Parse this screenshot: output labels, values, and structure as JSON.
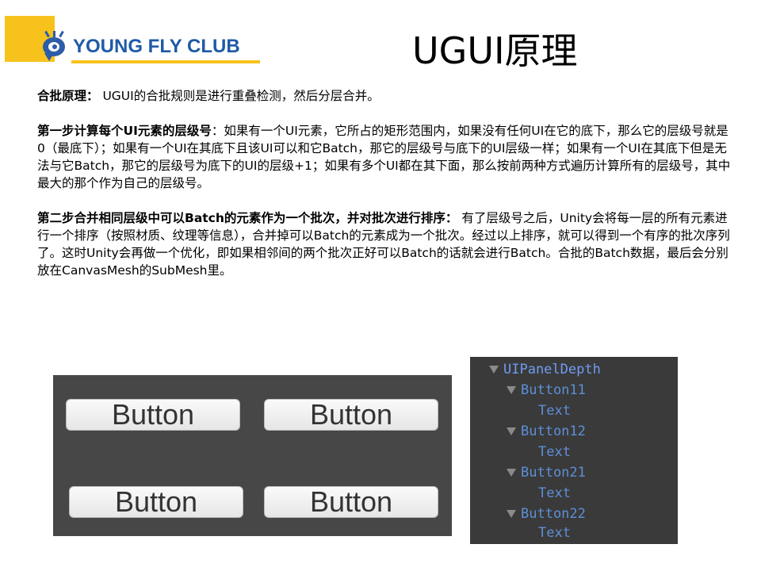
{
  "logo": {
    "text": "YOUNG FLY CLUB",
    "accent_color": "#f7c21c",
    "text_color": "#1f5aa8"
  },
  "title": "UGUI原理",
  "paragraphs": [
    {
      "heading": "合批原理：",
      "body": " UGUI的合批规则是进行重叠检测，然后分层合并。"
    },
    {
      "heading": "第一步计算每个UI元素的层级号",
      "body": "：如果有一个UI元素，它所占的矩形范围内，如果没有任何UI在它的底下，那么它的层级号就是0（最底下）；如果有一个UI在其底下且该UI可以和它Batch，那它的层级号与底下的UI层级一样；如果有一个UI在其底下但是无法与它Batch，那它的层级号为底下的UI的层级+1；如果有多个UI都在其下面，那么按前两种方式遍历计算所有的层级号，其中最大的那个作为自己的层级号。"
    },
    {
      "heading": "第二步合并相同层级中可以Batch的元素作为一个批次，并对批次进行排序：",
      "body": " 有了层级号之后，Unity会将每一层的所有元素进行一个排序（按照材质、纹理等信息），合并掉可以Batch的元素成为一个批次。经过以上排序，就可以得到一个有序的批次序列了。这时Unity会再做一个优化，即如果相邻间的两个批次正好可以Batch的话就会进行Batch。合批的Batch数据，最后会分别放在CanvasMesh的SubMesh里。"
    }
  ],
  "scene_view": {
    "background": "#474747",
    "buttons": [
      {
        "label": "Button"
      },
      {
        "label": "Button"
      },
      {
        "label": "Button"
      },
      {
        "label": "Button"
      }
    ]
  },
  "hierarchy": {
    "background": "#3a3a3a",
    "root": "UIPanelDepth",
    "items": [
      {
        "name": "Button11",
        "child": "Text"
      },
      {
        "name": "Button12",
        "child": "Text"
      },
      {
        "name": "Button21",
        "child": "Text"
      },
      {
        "name": "Button22",
        "child": "Text"
      }
    ]
  }
}
